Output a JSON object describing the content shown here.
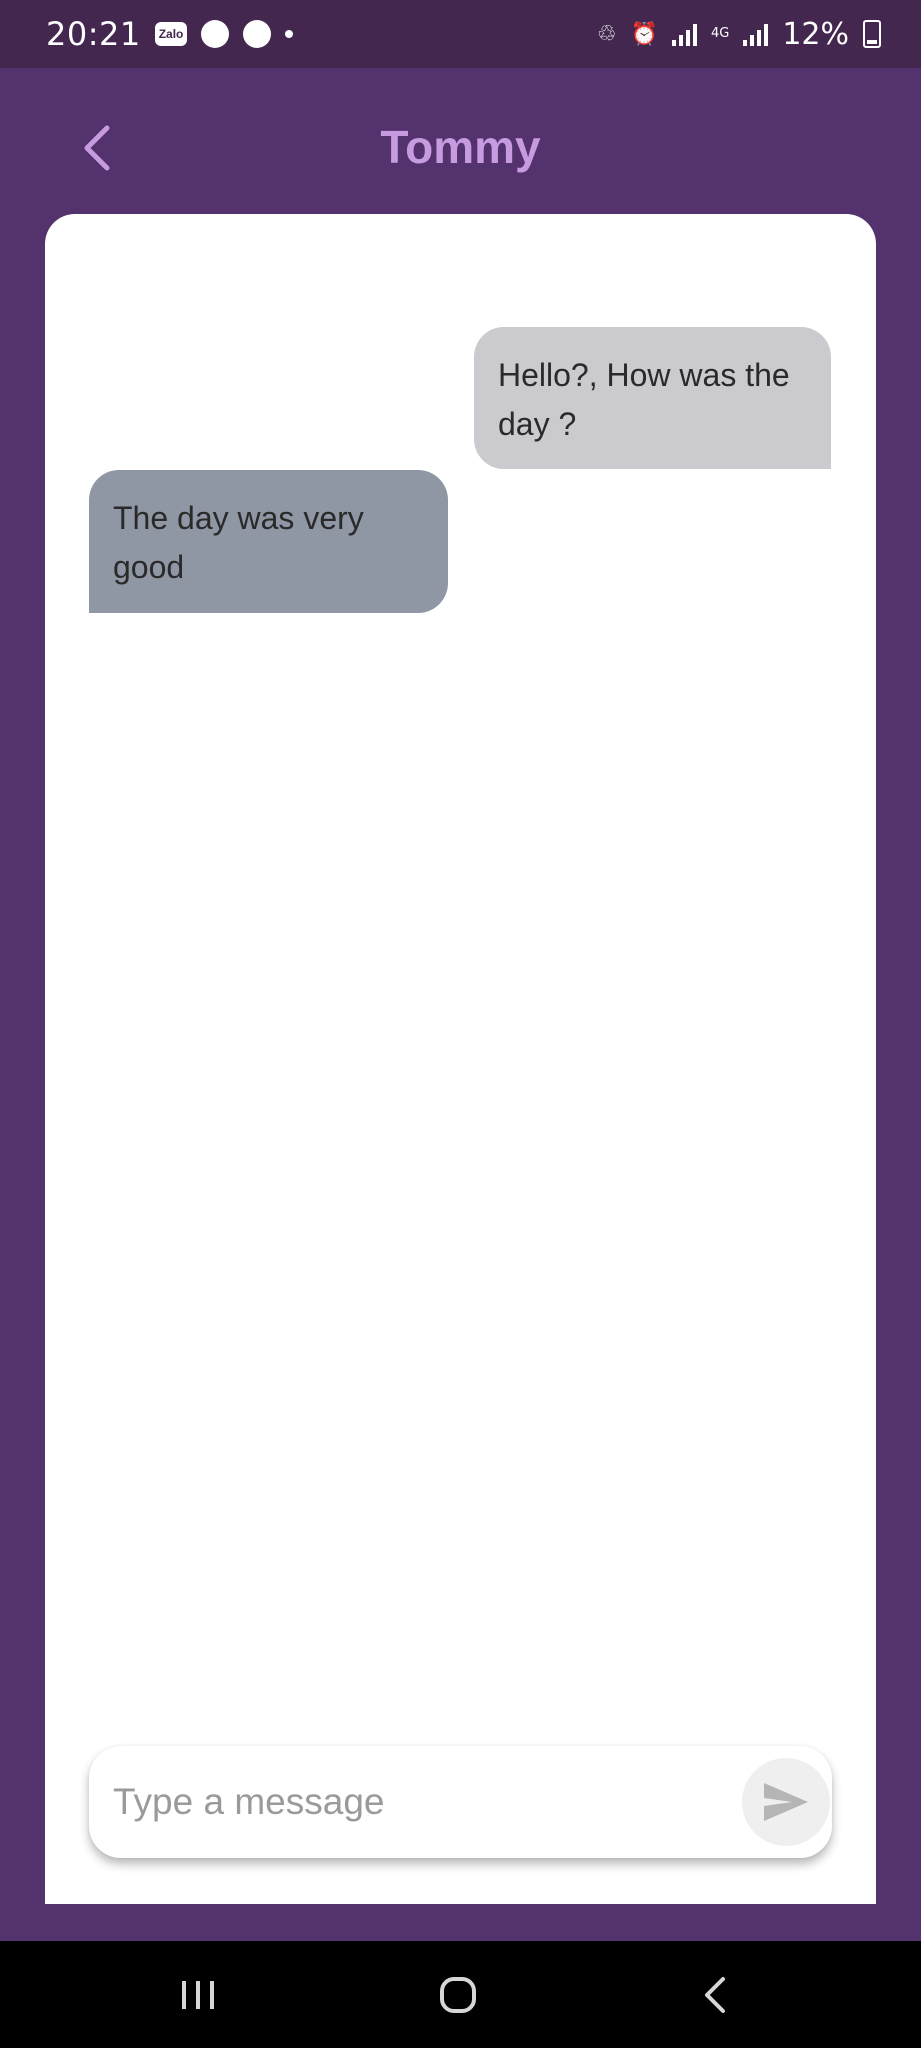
{
  "status_bar": {
    "time": "20:21",
    "zalo_label": "Zalo",
    "network_type": "4G",
    "battery_percent": "12%"
  },
  "header": {
    "title": "Tommy"
  },
  "messages": [
    {
      "direction": "sent",
      "text": "Hello?, How was the day ?"
    },
    {
      "direction": "received",
      "text": "The day was very good"
    }
  ],
  "composer": {
    "placeholder": "Type a message",
    "value": ""
  },
  "colors": {
    "app_background": "#53326e",
    "status_bar": "#43274f",
    "title": "#c79be0",
    "sent_bubble": "#cacacf",
    "received_bubble": "#8f96a4"
  },
  "icons": {
    "back": "chevron-left-icon",
    "send": "send-icon",
    "nav_recents": "recents-icon",
    "nav_home": "home-icon",
    "nav_back": "back-icon"
  }
}
